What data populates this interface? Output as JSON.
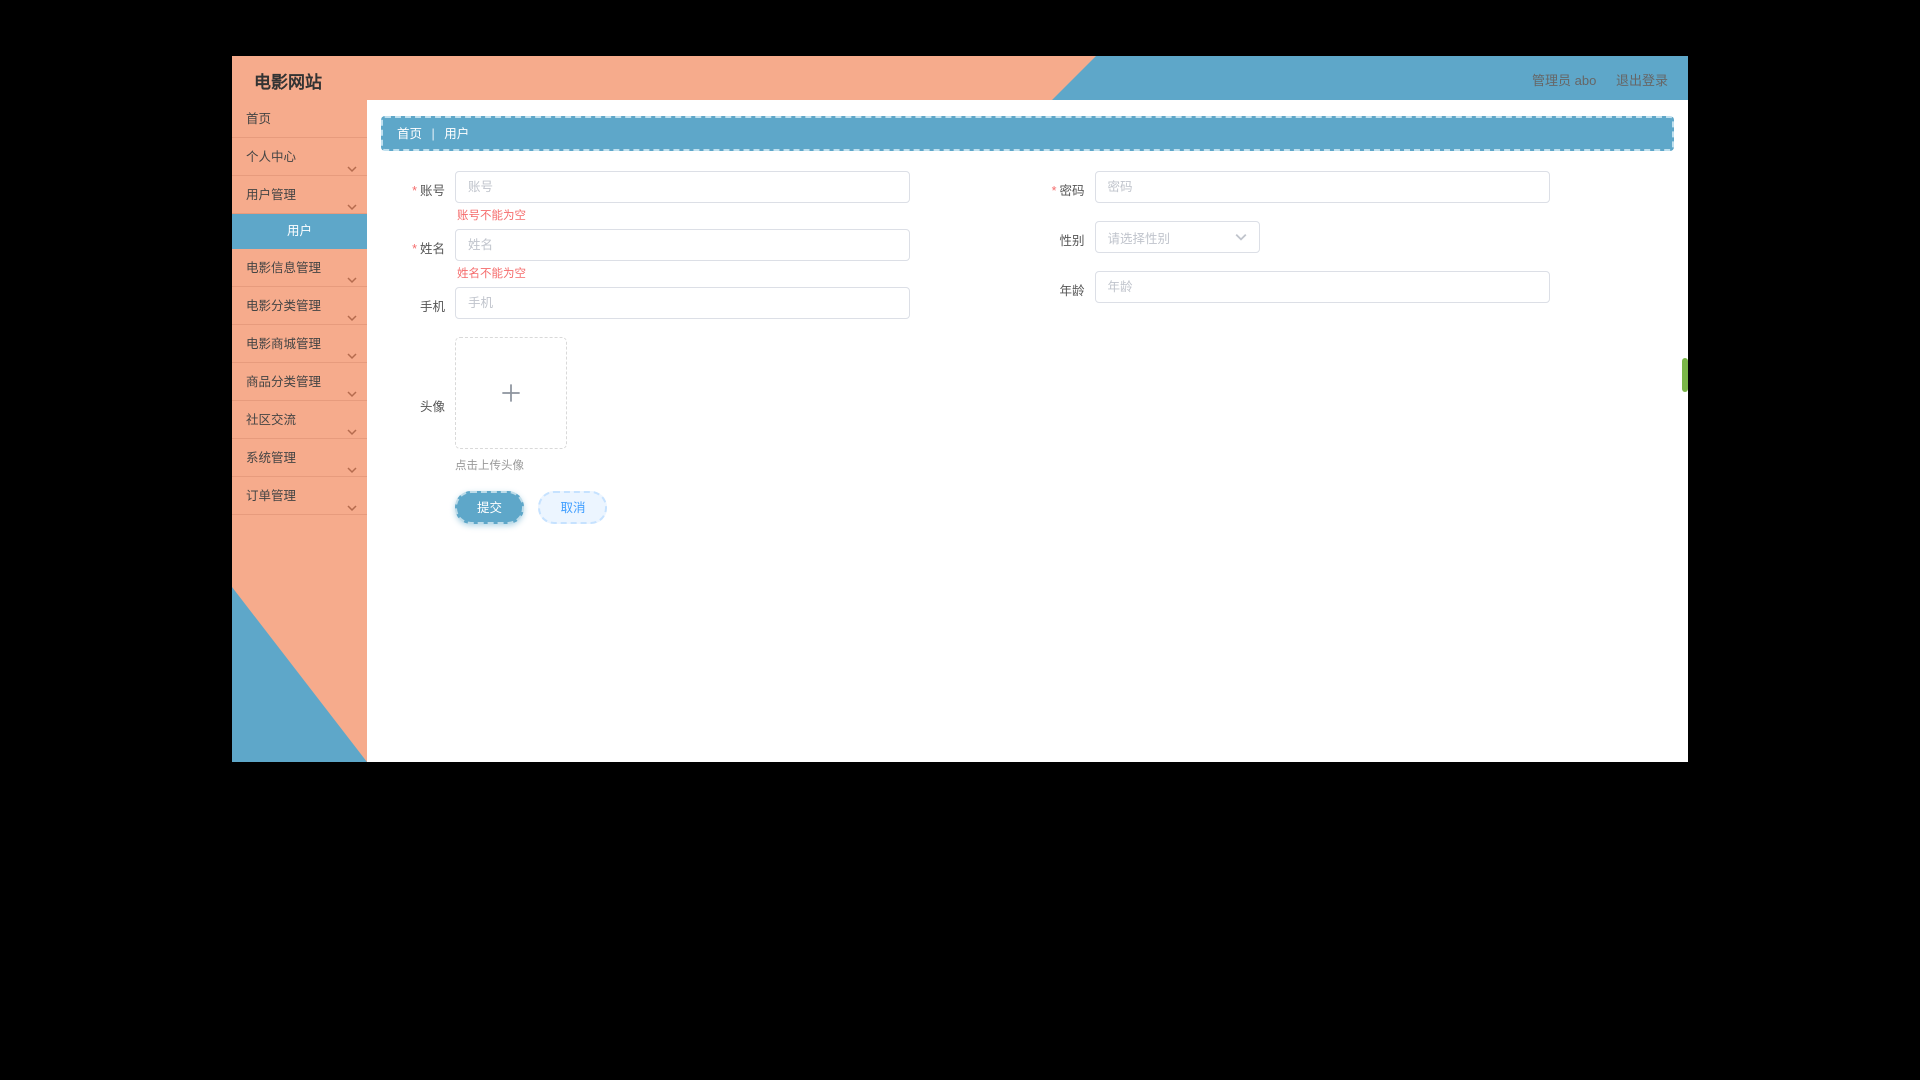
{
  "header": {
    "brand": "电影网站",
    "admin_label": "管理员 abo",
    "logout_label": "退出登录"
  },
  "sidebar": {
    "items": [
      {
        "label": "首页",
        "expandable": false
      },
      {
        "label": "个人中心",
        "expandable": true
      },
      {
        "label": "用户管理",
        "expandable": true,
        "sub": "用户"
      },
      {
        "label": "电影信息管理",
        "expandable": true
      },
      {
        "label": "电影分类管理",
        "expandable": true
      },
      {
        "label": "电影商城管理",
        "expandable": true
      },
      {
        "label": "商品分类管理",
        "expandable": true
      },
      {
        "label": "社区交流",
        "expandable": true
      },
      {
        "label": "系统管理",
        "expandable": true
      },
      {
        "label": "订单管理",
        "expandable": true
      }
    ]
  },
  "breadcrumb": {
    "root": "首页",
    "current": "用户"
  },
  "form": {
    "account": {
      "label": "账号",
      "placeholder": "账号",
      "error": "账号不能为空",
      "required": true
    },
    "password": {
      "label": "密码",
      "placeholder": "密码",
      "required": true
    },
    "name": {
      "label": "姓名",
      "placeholder": "姓名",
      "error": "姓名不能为空",
      "required": true
    },
    "gender": {
      "label": "性别",
      "placeholder": "请选择性别"
    },
    "phone": {
      "label": "手机",
      "placeholder": "手机"
    },
    "age": {
      "label": "年龄",
      "placeholder": "年龄"
    },
    "avatar": {
      "label": "头像",
      "tip": "点击上传头像"
    }
  },
  "buttons": {
    "submit": "提交",
    "cancel": "取消"
  }
}
